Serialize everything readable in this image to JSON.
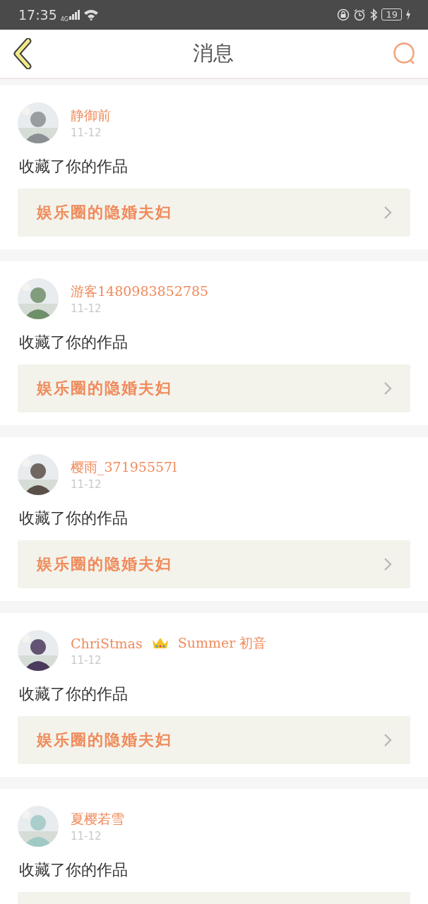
{
  "status_bar": {
    "time": "17:35",
    "network": "4G",
    "battery": "19"
  },
  "header": {
    "title": "消息"
  },
  "messages": [
    {
      "avatar": {
        "kind": "picture"
      },
      "name": [
        "静御前"
      ],
      "crown": false,
      "date": "11-12",
      "action": "收藏了你的作品",
      "work": "娱乐圈的隐婚夫妇"
    },
    {
      "avatar": {
        "kind": "picture"
      },
      "name": [
        "游客1480983852785"
      ],
      "crown": false,
      "date": "11-12",
      "action": "收藏了你的作品",
      "work": "娱乐圈的隐婚夫妇"
    },
    {
      "avatar": {
        "kind": "picture"
      },
      "name": [
        "樱雨_37195557l"
      ],
      "crown": false,
      "date": "11-12",
      "action": "收藏了你的作品",
      "work": "娱乐圈的隐婚夫妇"
    },
    {
      "avatar": {
        "kind": "picture"
      },
      "name": [
        "ChriStmas",
        "Summer 初音"
      ],
      "crown": true,
      "date": "11-12",
      "action": "收藏了你的作品",
      "work": "娱乐圈的隐婚夫妇"
    },
    {
      "avatar": {
        "kind": "picture"
      },
      "name": [
        "夏樱若雪"
      ],
      "crown": false,
      "date": "11-12",
      "action": "收藏了你的作品"
    }
  ]
}
